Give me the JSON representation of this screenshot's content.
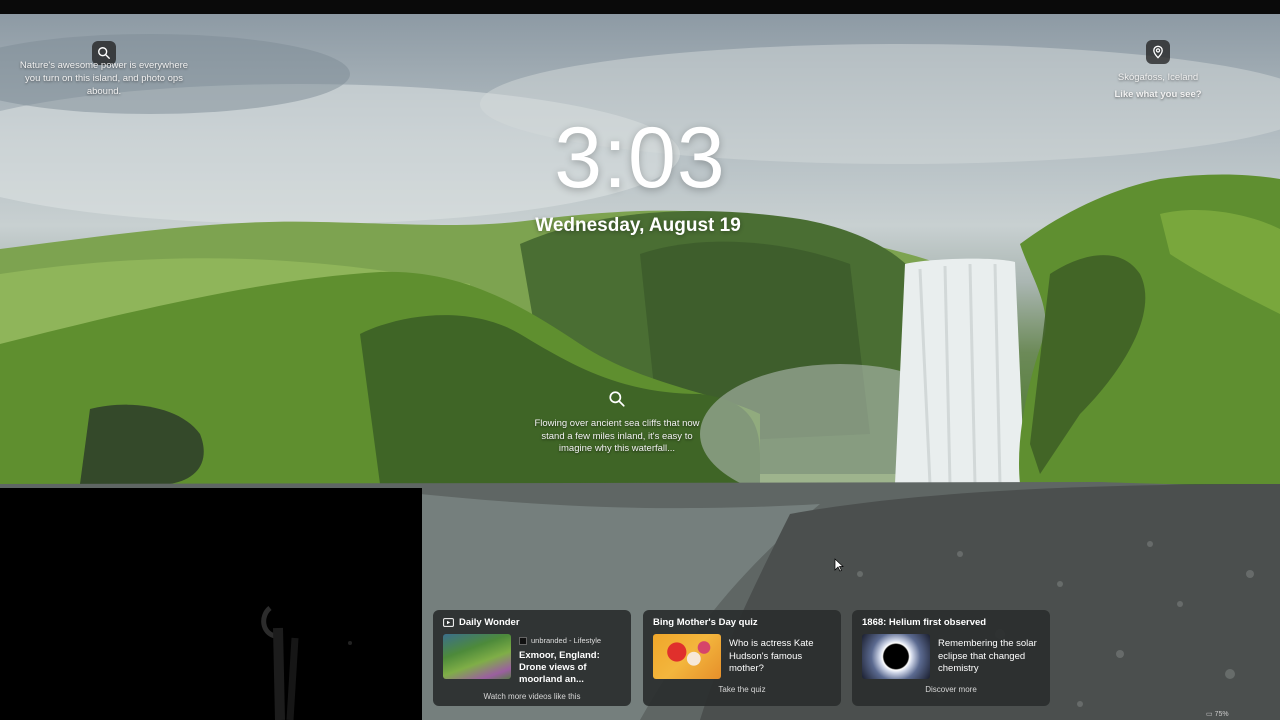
{
  "lockscreen": {
    "time": "3:03",
    "date": "Wednesday, August 19"
  },
  "tips": {
    "left_text": "Nature's awesome power is everywhere you turn on this island, and photo ops abound.",
    "location": "Skógafoss, Iceland",
    "like_prompt": "Like what you see?",
    "center_text": "Flowing over ancient sea cliffs that now stand a few miles inland, it's easy to imagine why this waterfall..."
  },
  "icons": {
    "left_tip": "search-icon",
    "right_tip": "location-pin-icon",
    "center_tip": "search-icon",
    "video": "video-icon"
  },
  "cards": [
    {
      "title": "Daily Wonder",
      "source": "unbranded - Lifestyle",
      "headline": "Exmoor, England: Drone views of moorland an...",
      "link": "Watch more videos like this"
    },
    {
      "title": "Bing Mother's Day quiz",
      "question": "Who is actress Kate Hudson's famous mother?",
      "link": "Take the quiz"
    },
    {
      "title": "1868: Helium first observed",
      "question": "Remembering the solar eclipse that changed chemistry",
      "link": "Discover more"
    }
  ],
  "tray": {
    "battery": "75%"
  }
}
